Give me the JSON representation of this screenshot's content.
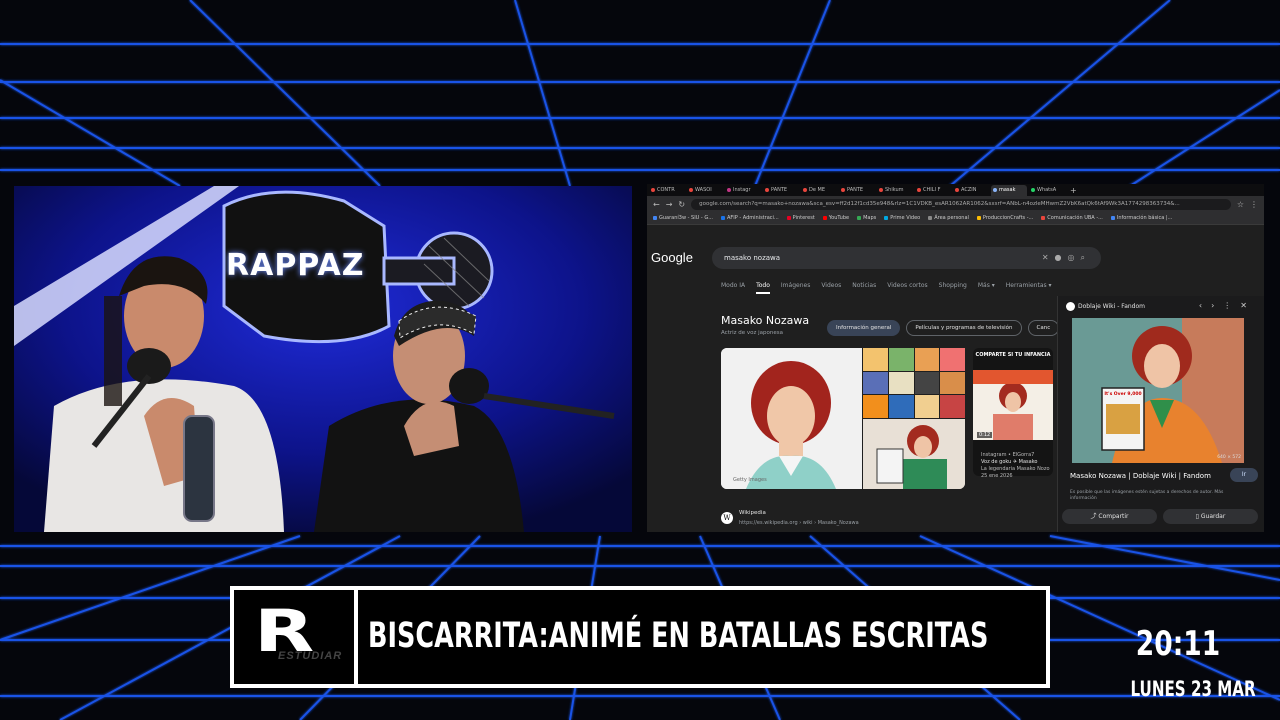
{
  "stream": {
    "logo_text": "RAPPAZ",
    "brand_sub": "ESTUDIAR",
    "brand_letter": "R",
    "show_title": "BISCARRITA:ANIMÉ EN BATALLAS ESCRITAS",
    "clock": "20:11",
    "date": "LUNES 23 MAR"
  },
  "browser": {
    "tabs": [
      {
        "label": "CONTR",
        "color": "#e8453c"
      },
      {
        "label": "WASOI",
        "color": "#e8453c"
      },
      {
        "label": "Instagr",
        "color": "#c13584"
      },
      {
        "label": "PANTE",
        "color": "#e8453c"
      },
      {
        "label": "De ME",
        "color": "#e8453c"
      },
      {
        "label": "PANTE",
        "color": "#e8453c"
      },
      {
        "label": "Shikum",
        "color": "#e8453c"
      },
      {
        "label": "CHILI F",
        "color": "#e8453c"
      },
      {
        "label": "ACZIN",
        "color": "#e8453c"
      },
      {
        "label": "masak",
        "color": "#8ab4f8"
      },
      {
        "label": "WhatsA",
        "color": "#25d366"
      }
    ],
    "url": "google.com/search?q=masako+nozawa&sca_esv=ff2d12f1cd35e948&rlz=1C1VDKB_esAR1062AR1062&sxsrf=ANbL-n4ozleMHwmZ2VbK6atQk6tAf9Wk3A1774298363734&...",
    "bookmarks": [
      {
        "label": "Guaraní3w - SIU - G...",
        "color": "#4285f4"
      },
      {
        "label": "AFIP - Administraci...",
        "color": "#1a73e8"
      },
      {
        "label": "Pinterest",
        "color": "#e60023"
      },
      {
        "label": "YouTube",
        "color": "#ff0000"
      },
      {
        "label": "Maps",
        "color": "#34a853"
      },
      {
        "label": "Prime Video",
        "color": "#00a8e1"
      },
      {
        "label": "Área personal",
        "color": "#888888"
      },
      {
        "label": "ProduccionCrafts -...",
        "color": "#fbbc04"
      },
      {
        "label": "Comunicación UBA -...",
        "color": "#e8453c"
      },
      {
        "label": "Información básica |...",
        "color": "#4285f4"
      }
    ],
    "google_logo": "Google",
    "search_query": "masako nozawa",
    "search_tabs": [
      "Modo IA",
      "Todo",
      "Imágenes",
      "Videos",
      "Noticias",
      "Videos cortos",
      "Shopping",
      "Más ▾",
      "Herramientas ▾"
    ],
    "active_search_tab": "Todo",
    "kp_title": "Masako Nozawa",
    "kp_subtitle": "Actriz de voz japonesa",
    "chips": [
      "Información general",
      "Películas y programas de televisión",
      "Canc"
    ],
    "card_heading": "COMPARTE SI TU INFANCIA",
    "card_duration": "0:12",
    "card_source": "Instagram • ElGorra7",
    "card_caption": "Voz de goku ✈ Masako",
    "card_line2": "La legendaria Masako Nozo",
    "card_date": "25 ene 2026",
    "img_credit": "Getty Images",
    "wiki_label": "Wikipedia",
    "wiki_url": "https://es.wikipedia.org › wiki › Masako_Nozawa",
    "side_title": "Doblaje Wiki - Fandom",
    "side_name": "Masako Nozawa | Doblaje Wiki | Fandom",
    "side_visit": "Ir",
    "side_note": "Es posible que las imágenes estén sujetas a derechos de autor. Más información",
    "side_res": "640 × 572",
    "side_share": "Compartir",
    "side_save": "Guardar",
    "side_book": "It's Over 9,000"
  }
}
